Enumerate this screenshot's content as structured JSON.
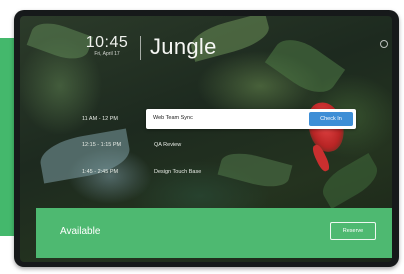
{
  "clock": {
    "time": "10:45",
    "date": "Fri, April 17"
  },
  "room": {
    "name": "Jungle"
  },
  "schedule": {
    "events": [
      {
        "time": "11 AM - 12 PM",
        "title": "Web Team Sync",
        "action": "Check In",
        "current": true
      },
      {
        "time": "12:15 - 1:15 PM",
        "title": "QA Review",
        "current": false
      },
      {
        "time": "1:45 - 2:45 PM",
        "title": "Design Touch Base",
        "current": false
      }
    ]
  },
  "status": {
    "label": "Available",
    "reserve_label": "Reserve"
  },
  "colors": {
    "available": "#4eb971",
    "checkin": "#3d8ed6",
    "flower": "#d93a3a"
  },
  "icons": {
    "settings": "settings-dot-icon"
  }
}
